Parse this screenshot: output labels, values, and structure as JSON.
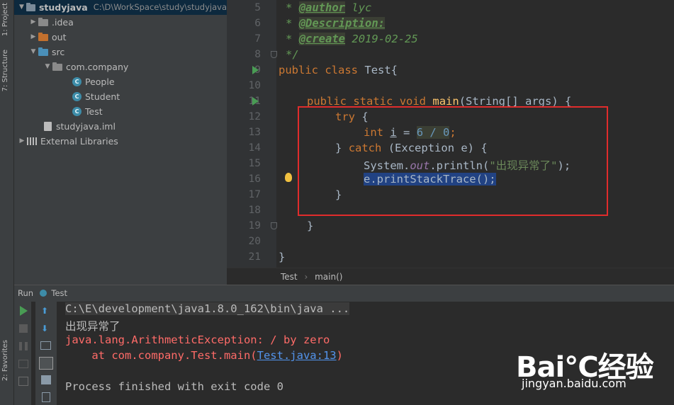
{
  "sidebar_tabs": {
    "project": "1: Project",
    "structure": "7: Structure",
    "favorites": "2: Favorites"
  },
  "project_tree": {
    "root": {
      "label": "studyjava",
      "path": "C:\\D\\WorkSpace\\study\\studyjava"
    },
    "items": [
      {
        "label": "idea",
        "display": ".idea"
      },
      {
        "label": "out"
      },
      {
        "label": "src"
      },
      {
        "label": "com.company"
      },
      {
        "label": "People"
      },
      {
        "label": "Student"
      },
      {
        "label": "Test"
      },
      {
        "label": "studyjava.iml"
      },
      {
        "label": "External Libraries"
      }
    ]
  },
  "editor": {
    "line_numbers": [
      "5",
      "6",
      "7",
      "8",
      "9",
      "10",
      "11",
      "12",
      "13",
      "14",
      "15",
      "16",
      "17",
      "18",
      "19",
      "20",
      "21"
    ],
    "comment": {
      "star": "*",
      "author_tag": "@author",
      "author": "lyc",
      "desc_tag": "@Description:",
      "create_tag": "@create",
      "create_date": "2019-02-25",
      "end": "*/"
    },
    "code": {
      "public": "public",
      "class": "class",
      "class_name": "Test{",
      "static": "static",
      "void": "void",
      "main": "main",
      "main_args": "(String[] args) {",
      "try": "try",
      "brace_open": "{",
      "int": "int",
      "var": "i",
      "assign": "=",
      "expr": "6 / 0",
      "semicolon": ";",
      "close_catch": "}",
      "catch": "catch",
      "catch_args": "(Exception e) {",
      "system": "System.",
      "out": "out",
      "println": ".println(",
      "string": "\"出现异常了\"",
      "println_end": ");",
      "print_stack": "e.printStackTrace();",
      "brace_close": "}"
    }
  },
  "breadcrumb": {
    "class": "Test",
    "sep": "›",
    "method": "main()"
  },
  "run_panel": {
    "label": "Run",
    "config": "Test"
  },
  "console": {
    "command": "C:\\E\\development\\java1.8.0_162\\bin\\java ...",
    "output": "出现异常了",
    "exception": "java.lang.ArithmeticException: / by zero",
    "stack_prefix": "    at com.company.Test.main(",
    "stack_link": "Test.java:13",
    "stack_suffix": ")",
    "finished": "Process finished with exit code 0"
  },
  "watermark": {
    "logo": "Bai℃经验",
    "url": "jingyan.baidu.com"
  },
  "colors": {
    "error": "#ff6b68",
    "highlight_box": "#e02c2c",
    "selection": "#214283"
  }
}
